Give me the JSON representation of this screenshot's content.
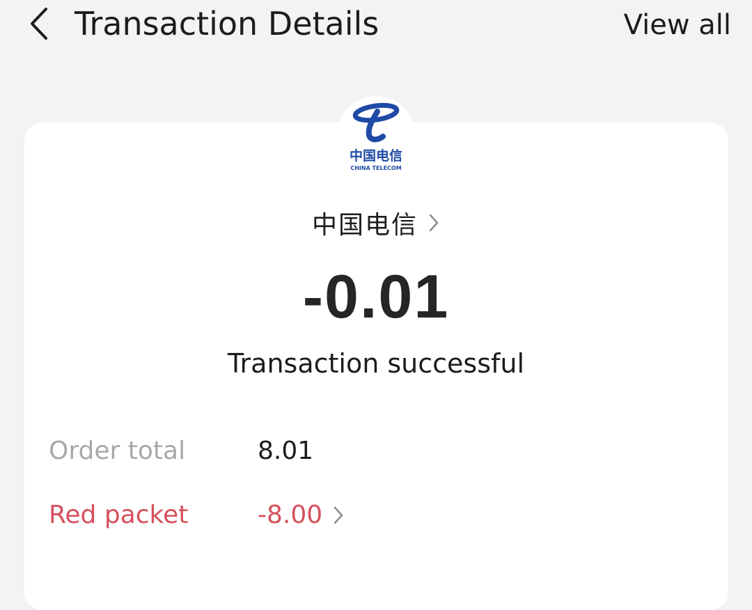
{
  "header": {
    "title": "Transaction Details",
    "view_all_label": "View all",
    "back_icon": "chevron-left-icon"
  },
  "merchant": {
    "logo_icon": "china-telecom-logo",
    "logo_text": "中国电信",
    "logo_subtext": "CHINA TELECOM",
    "brand_color": "#1f4aa6",
    "name": "中国电信"
  },
  "transaction": {
    "amount": "-0.01",
    "status": "Transaction successful"
  },
  "details": [
    {
      "label": "Order total",
      "value": "8.01"
    },
    {
      "label": "Red packet",
      "value": "-8.00"
    }
  ],
  "colors": {
    "background": "#f3f3f3",
    "card": "#ffffff",
    "muted_label": "#a8a8a8",
    "red_packet": "#d5505c"
  }
}
